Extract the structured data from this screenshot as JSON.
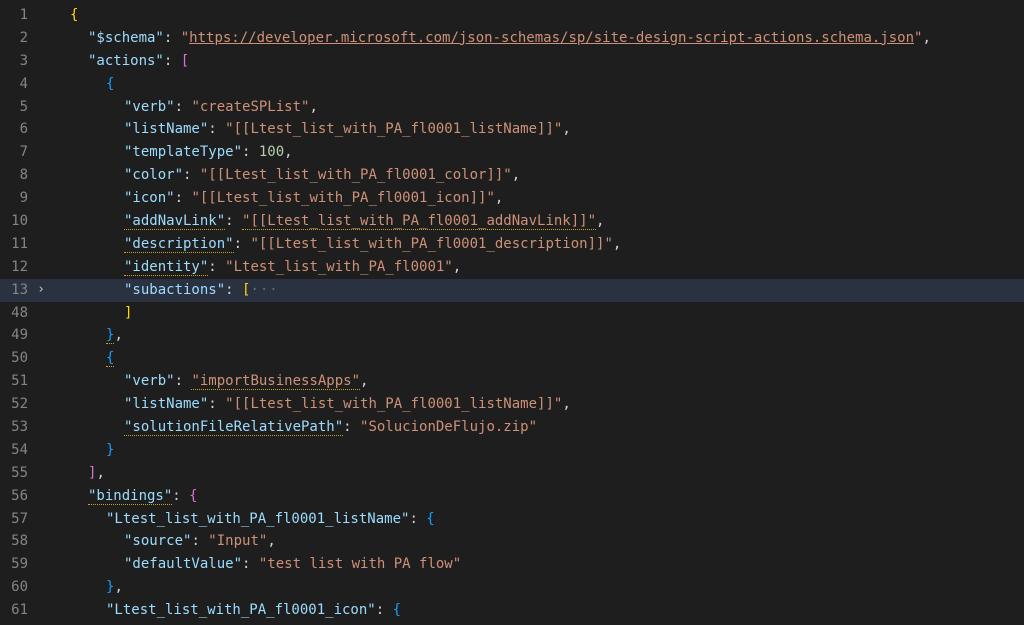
{
  "editor": {
    "collapsed_hint": "···",
    "fold_caret": "›",
    "lines": [
      {
        "n": "1",
        "i": 1,
        "segs": [
          {
            "t": "{",
            "c": "brace"
          }
        ]
      },
      {
        "n": "2",
        "i": 2,
        "segs": [
          {
            "t": "\"$schema\"",
            "c": "key"
          },
          {
            "t": ": ",
            "c": "punct"
          },
          {
            "t": "\"",
            "c": "str"
          },
          {
            "t": "https://developer.microsoft.com/json-schemas/sp/site-design-script-actions.schema.json",
            "c": "str",
            "u": true
          },
          {
            "t": "\"",
            "c": "str"
          },
          {
            "t": ",",
            "c": "punct"
          }
        ]
      },
      {
        "n": "3",
        "i": 2,
        "segs": [
          {
            "t": "\"actions\"",
            "c": "key"
          },
          {
            "t": ": ",
            "c": "punct"
          },
          {
            "t": "[",
            "c": "bracket"
          }
        ]
      },
      {
        "n": "4",
        "i": 3,
        "segs": [
          {
            "t": "{",
            "c": "brace2"
          }
        ]
      },
      {
        "n": "5",
        "i": 4,
        "segs": [
          {
            "t": "\"verb\"",
            "c": "key"
          },
          {
            "t": ": ",
            "c": "punct"
          },
          {
            "t": "\"createSPList\"",
            "c": "str"
          },
          {
            "t": ",",
            "c": "punct"
          }
        ]
      },
      {
        "n": "6",
        "i": 4,
        "segs": [
          {
            "t": "\"listName\"",
            "c": "key"
          },
          {
            "t": ": ",
            "c": "punct"
          },
          {
            "t": "\"[[Ltest_list_with_PA_fl0001_listName]]\"",
            "c": "str"
          },
          {
            "t": ",",
            "c": "punct"
          }
        ]
      },
      {
        "n": "7",
        "i": 4,
        "segs": [
          {
            "t": "\"templateType\"",
            "c": "key"
          },
          {
            "t": ": ",
            "c": "punct"
          },
          {
            "t": "100",
            "c": "num"
          },
          {
            "t": ",",
            "c": "punct"
          }
        ]
      },
      {
        "n": "8",
        "i": 4,
        "segs": [
          {
            "t": "\"color\"",
            "c": "key"
          },
          {
            "t": ": ",
            "c": "punct"
          },
          {
            "t": "\"[[Ltest_list_with_PA_fl0001_color]]\"",
            "c": "str"
          },
          {
            "t": ",",
            "c": "punct"
          }
        ]
      },
      {
        "n": "9",
        "i": 4,
        "segs": [
          {
            "t": "\"icon\"",
            "c": "key"
          },
          {
            "t": ": ",
            "c": "punct"
          },
          {
            "t": "\"[[Ltest_list_with_PA_fl0001_icon]]\"",
            "c": "str"
          },
          {
            "t": ",",
            "c": "punct"
          }
        ]
      },
      {
        "n": "10",
        "i": 4,
        "segs": [
          {
            "t": "\"addNavLink\"",
            "c": "key",
            "s": true
          },
          {
            "t": ": ",
            "c": "punct"
          },
          {
            "t": "\"[[Ltest_list_with_PA_fl0001_addNavLink]]\"",
            "c": "str",
            "s": true
          },
          {
            "t": ",",
            "c": "punct"
          }
        ]
      },
      {
        "n": "11",
        "i": 4,
        "segs": [
          {
            "t": "\"description\"",
            "c": "key",
            "s": true
          },
          {
            "t": ": ",
            "c": "punct"
          },
          {
            "t": "\"[[Ltest_list_with_PA_fl0001_description]]\"",
            "c": "str"
          },
          {
            "t": ",",
            "c": "punct"
          }
        ]
      },
      {
        "n": "12",
        "i": 4,
        "segs": [
          {
            "t": "\"identity\"",
            "c": "key",
            "s": true
          },
          {
            "t": ": ",
            "c": "punct"
          },
          {
            "t": "\"Ltest_list_with_PA_fl0001\"",
            "c": "str"
          },
          {
            "t": ",",
            "c": "punct"
          }
        ]
      },
      {
        "n": "13",
        "i": 4,
        "hl": true,
        "fold": true,
        "segs": [
          {
            "t": "\"subactions\"",
            "c": "key"
          },
          {
            "t": ": ",
            "c": "punct"
          },
          {
            "t": "[",
            "c": "brace"
          },
          {
            "t": "···",
            "c": "collapsed"
          }
        ]
      },
      {
        "n": "48",
        "i": 4,
        "segs": [
          {
            "t": "]",
            "c": "brace"
          }
        ]
      },
      {
        "n": "49",
        "i": 3,
        "segs": [
          {
            "t": "}",
            "c": "brace2",
            "s": true
          },
          {
            "t": ",",
            "c": "punct"
          }
        ]
      },
      {
        "n": "50",
        "i": 3,
        "segs": [
          {
            "t": "{",
            "c": "brace2",
            "s": true
          }
        ]
      },
      {
        "n": "51",
        "i": 4,
        "segs": [
          {
            "t": "\"verb\"",
            "c": "key"
          },
          {
            "t": ": ",
            "c": "punct"
          },
          {
            "t": "\"importBusinessApps\"",
            "c": "str",
            "s": true
          },
          {
            "t": ",",
            "c": "punct"
          }
        ]
      },
      {
        "n": "52",
        "i": 4,
        "segs": [
          {
            "t": "\"listName\"",
            "c": "key"
          },
          {
            "t": ": ",
            "c": "punct"
          },
          {
            "t": "\"[[Ltest_list_with_PA_fl0001_listName]]\"",
            "c": "str"
          },
          {
            "t": ",",
            "c": "punct"
          }
        ]
      },
      {
        "n": "53",
        "i": 4,
        "segs": [
          {
            "t": "\"solutionFileRelativePath\"",
            "c": "key",
            "s": true
          },
          {
            "t": ": ",
            "c": "punct"
          },
          {
            "t": "\"SolucionDeFlujo.zip\"",
            "c": "str"
          }
        ]
      },
      {
        "n": "54",
        "i": 3,
        "segs": [
          {
            "t": "}",
            "c": "brace2"
          }
        ]
      },
      {
        "n": "55",
        "i": 2,
        "segs": [
          {
            "t": "]",
            "c": "bracket"
          },
          {
            "t": ",",
            "c": "punct"
          }
        ]
      },
      {
        "n": "56",
        "i": 2,
        "segs": [
          {
            "t": "\"bindings\"",
            "c": "key",
            "s": true
          },
          {
            "t": ": ",
            "c": "punct"
          },
          {
            "t": "{",
            "c": "bracket"
          }
        ]
      },
      {
        "n": "57",
        "i": 3,
        "segs": [
          {
            "t": "\"Ltest_list_with_PA_fl0001_listName\"",
            "c": "key"
          },
          {
            "t": ": ",
            "c": "punct"
          },
          {
            "t": "{",
            "c": "brace2"
          }
        ]
      },
      {
        "n": "58",
        "i": 4,
        "segs": [
          {
            "t": "\"source\"",
            "c": "key"
          },
          {
            "t": ": ",
            "c": "punct"
          },
          {
            "t": "\"Input\"",
            "c": "str"
          },
          {
            "t": ",",
            "c": "punct"
          }
        ]
      },
      {
        "n": "59",
        "i": 4,
        "segs": [
          {
            "t": "\"defaultValue\"",
            "c": "key"
          },
          {
            "t": ": ",
            "c": "punct"
          },
          {
            "t": "\"test list with PA flow\"",
            "c": "str"
          }
        ]
      },
      {
        "n": "60",
        "i": 3,
        "segs": [
          {
            "t": "}",
            "c": "brace2"
          },
          {
            "t": ",",
            "c": "punct"
          }
        ]
      },
      {
        "n": "61",
        "i": 3,
        "segs": [
          {
            "t": "\"Ltest_list_with_PA_fl0001_icon\"",
            "c": "key"
          },
          {
            "t": ": ",
            "c": "punct"
          },
          {
            "t": "{",
            "c": "brace2"
          }
        ]
      }
    ]
  }
}
